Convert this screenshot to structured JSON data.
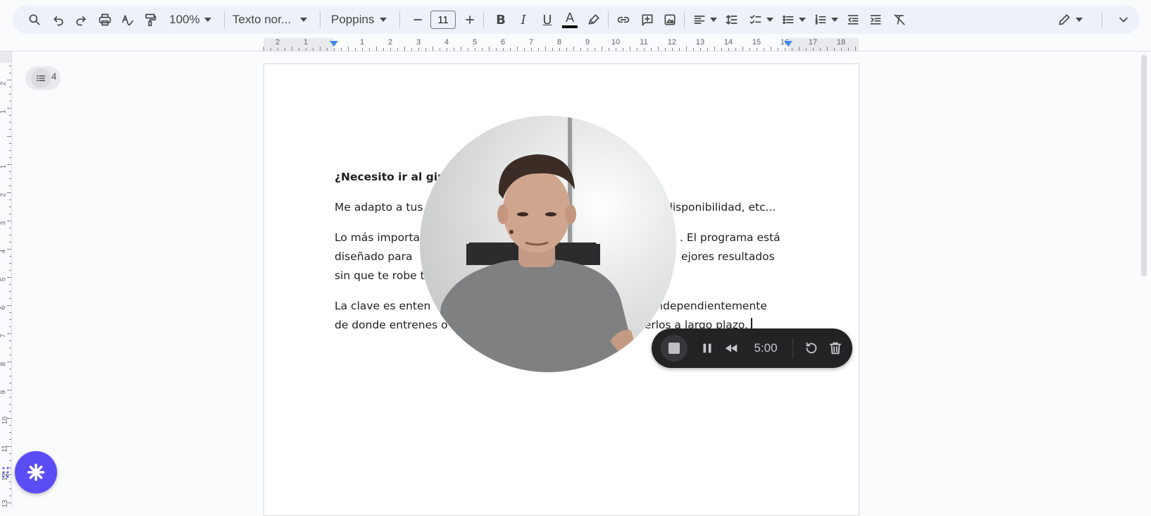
{
  "toolbar": {
    "zoom": "100%",
    "style": "Texto nor...",
    "font": "Poppins",
    "font_size": "11",
    "bold": "B",
    "italic": "I",
    "underline": "U",
    "text_color": "A"
  },
  "ruler": {
    "numbers": [
      "2",
      "1",
      "1",
      "2",
      "3",
      "4",
      "5",
      "6",
      "7",
      "8",
      "9",
      "10",
      "11",
      "12",
      "13",
      "14",
      "15",
      "16",
      "17",
      "18"
    ],
    "vertical_numbers": [
      "2",
      "1",
      "1",
      "2",
      "3",
      "4",
      "5",
      "6",
      "7",
      "8",
      "9",
      "10",
      "11",
      "12",
      "13"
    ]
  },
  "outline": {
    "count": "4"
  },
  "document": {
    "heading": "¿Necesito ir al gim",
    "p1": "Me adapto a tus",
    "p1_end": "disponibilidad, etc...",
    "p2_l1": "Lo más importa",
    "p2_l1_end": ". El programa está",
    "p2_l2": "diseñado para",
    "p2_l2_end": "ejores resultados",
    "p2_l3": "sin que te robe t",
    "p3_l1": "La clave es enten",
    "p3_l1_end": "independientemente",
    "p3_l2": "de donde entrenes o",
    "p3_l2_end": "nerlos a largo plazo."
  },
  "recorder": {
    "time": "5:00"
  },
  "colors": {
    "accent": "#5b4cf5",
    "recorder_bg": "#232326",
    "toolbar_bg": "#edf2fa"
  }
}
